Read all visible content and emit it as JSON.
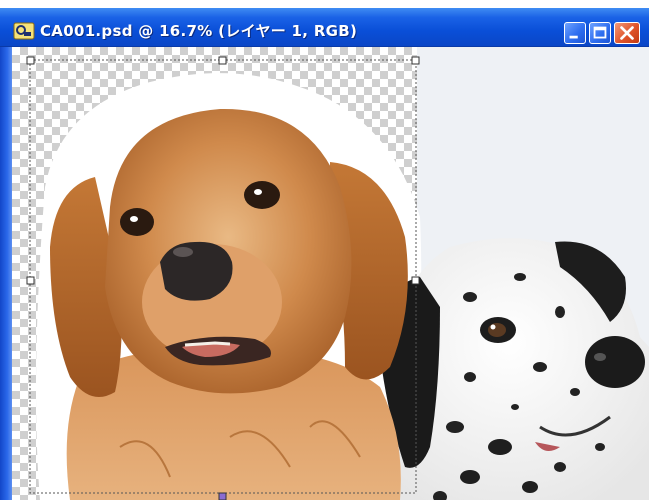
{
  "window": {
    "title": "CA001.psd @ 16.7% (レイヤー 1, RGB)"
  },
  "icons": {
    "app": "photoshop-app-icon",
    "minimize": "minimize-icon",
    "maximize": "maximize-icon",
    "close": "close-icon"
  },
  "colors": {
    "titlebar": "#0a4fd8",
    "close_button": "#e0542a",
    "selection_marquee": "#555555"
  }
}
